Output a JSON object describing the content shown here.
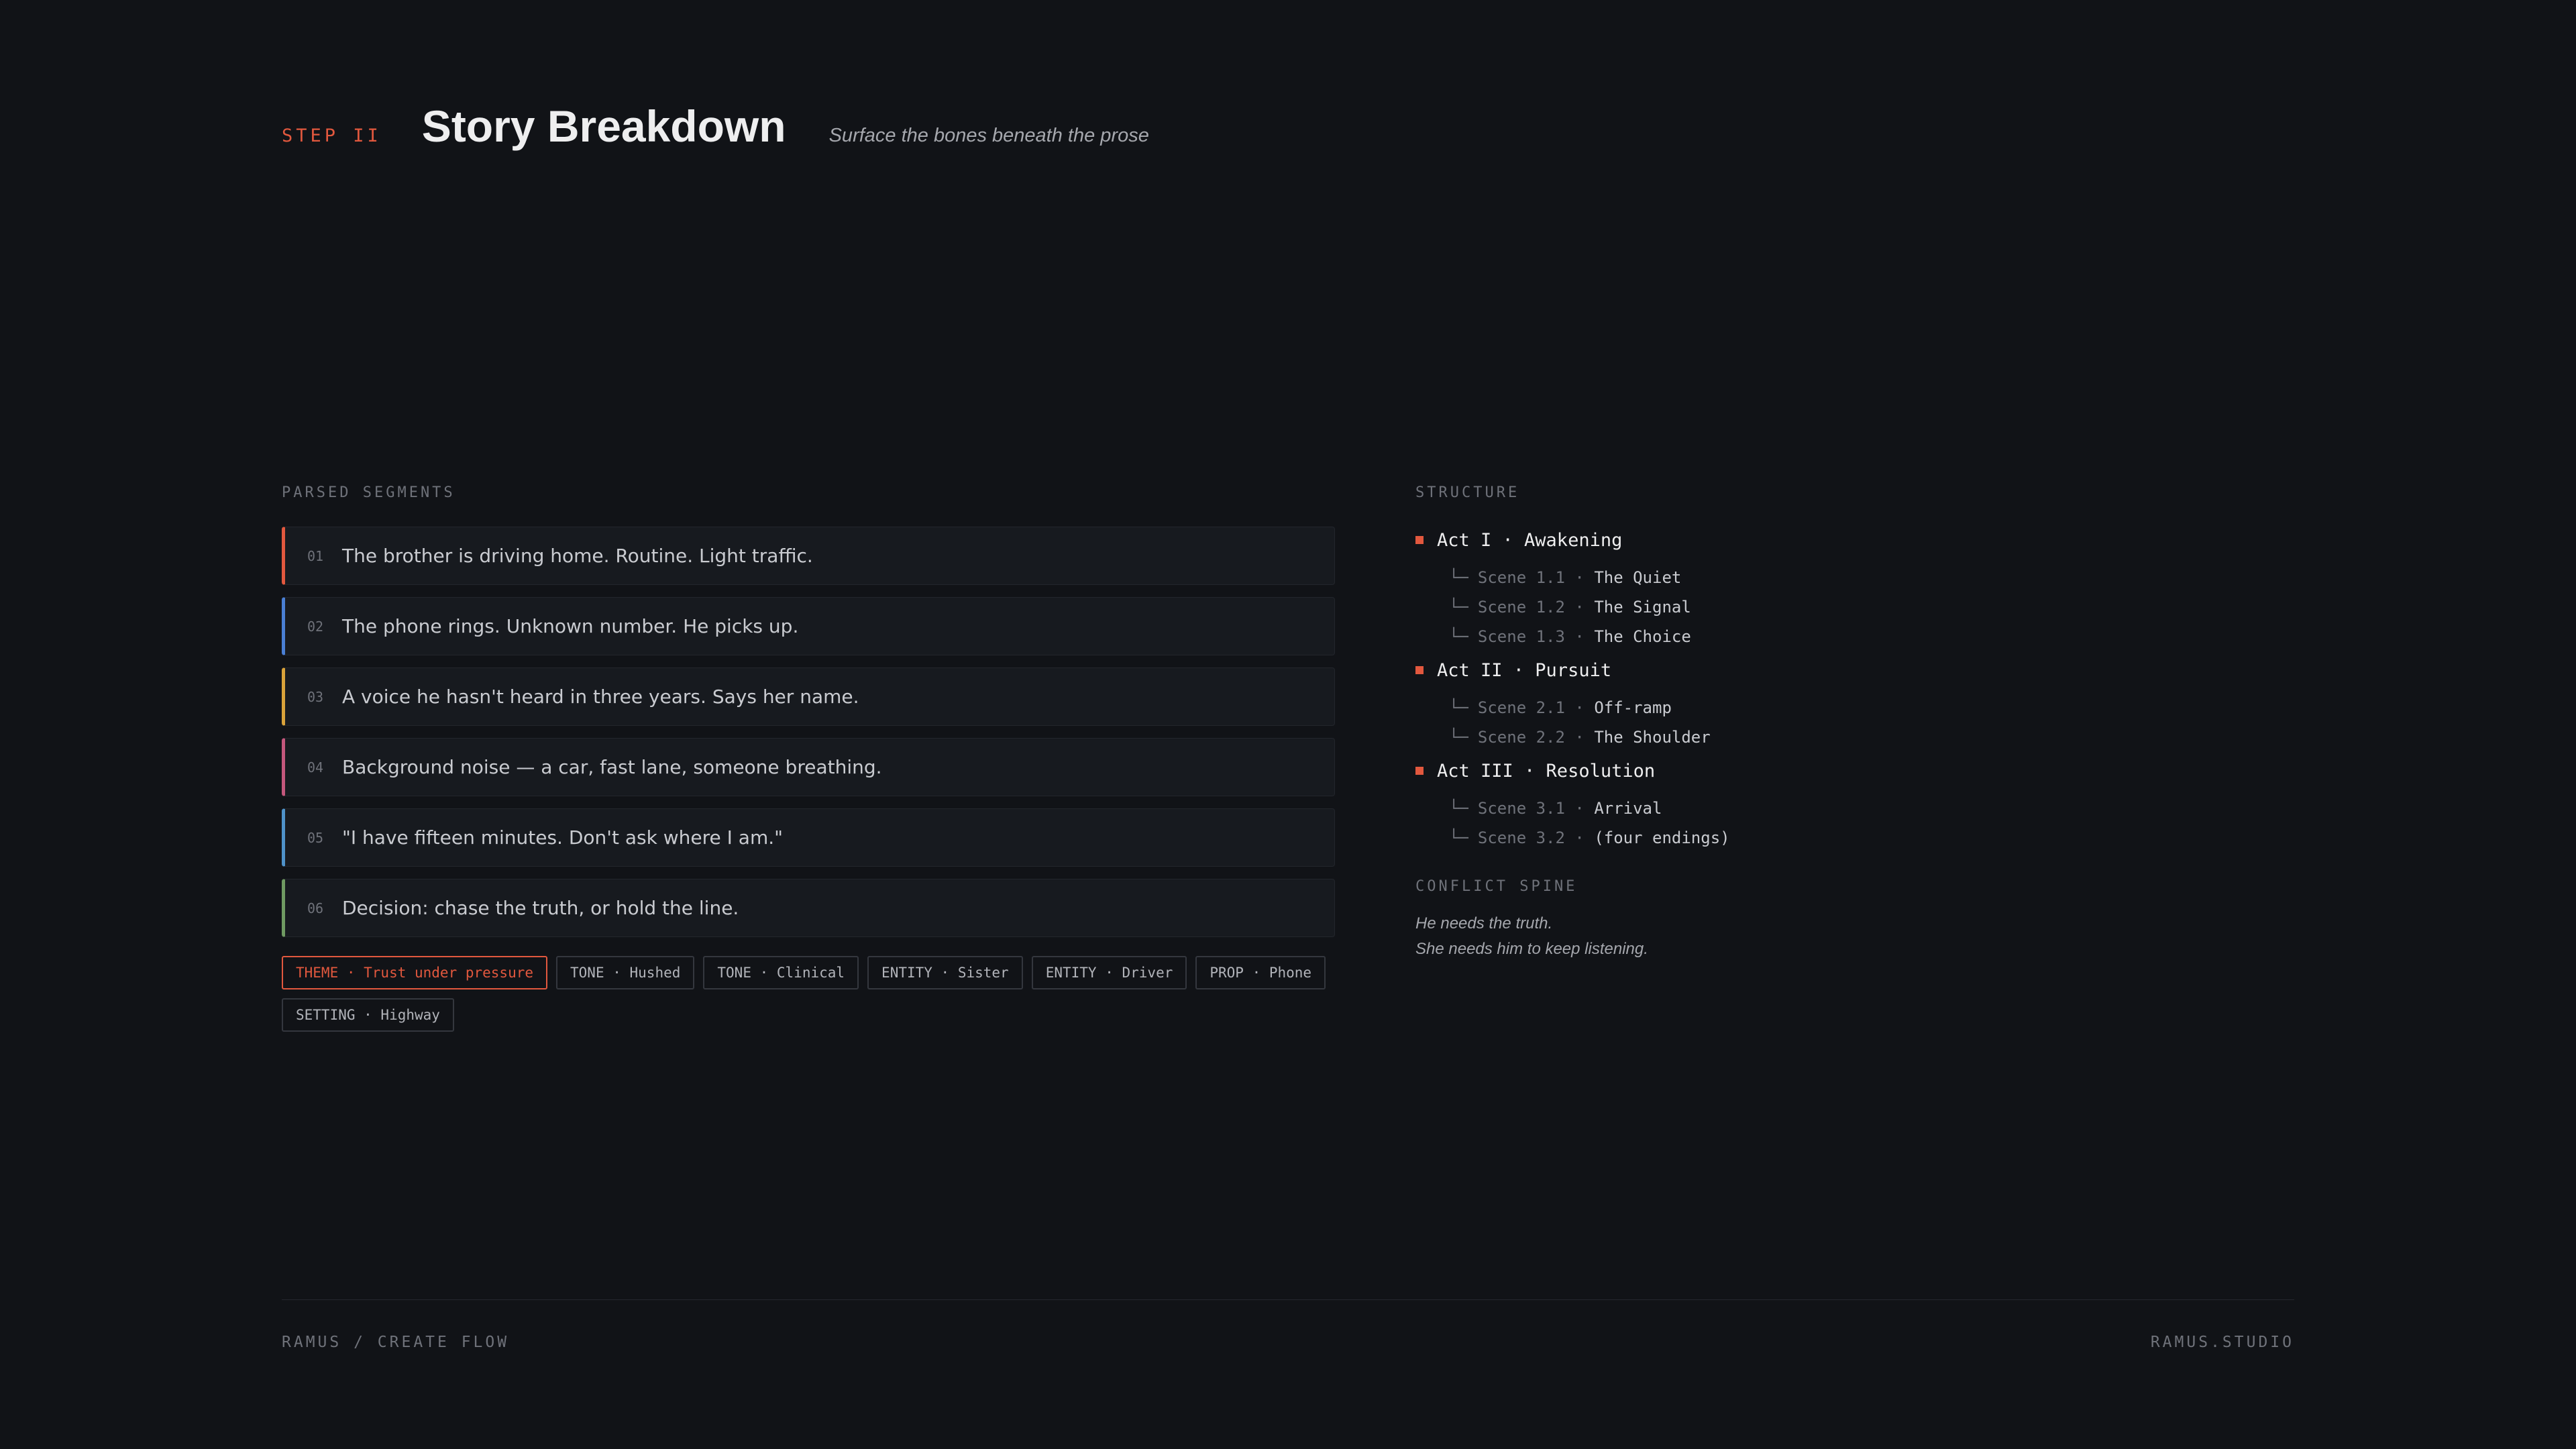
{
  "header": {
    "step": "STEP II",
    "title": "Story Breakdown",
    "subtitle": "Surface the bones beneath the prose"
  },
  "segments_section": {
    "label": "PARSED SEGMENTS",
    "items": [
      {
        "num": "01",
        "text": "The brother is driving home. Routine. Light traffic.",
        "color": "#e2583e"
      },
      {
        "num": "02",
        "text": "The phone rings. Unknown number. He picks up.",
        "color": "#4a7fd4"
      },
      {
        "num": "03",
        "text": "A voice he hasn't heard in three years. Says her name.",
        "color": "#d9a23a"
      },
      {
        "num": "04",
        "text": "Background noise — a car, fast lane, someone breathing.",
        "color": "#c4577c"
      },
      {
        "num": "05",
        "text": "\"I have fifteen minutes. Don't ask where I am.\"",
        "color": "#4f92c9"
      },
      {
        "num": "06",
        "text": "Decision: chase the truth, or hold the line.",
        "color": "#6f9a62"
      }
    ]
  },
  "tags": [
    {
      "text": "THEME · Trust under pressure",
      "primary": true
    },
    {
      "text": "TONE · Hushed"
    },
    {
      "text": "TONE · Clinical"
    },
    {
      "text": "ENTITY · Sister"
    },
    {
      "text": "ENTITY · Driver"
    },
    {
      "text": "PROP · Phone"
    },
    {
      "text": "SETTING · Highway"
    }
  ],
  "structure": {
    "label": "STRUCTURE",
    "acts": [
      {
        "title": "Act I · Awakening",
        "scenes": [
          {
            "label": "Scene 1.1",
            "name": "The Quiet"
          },
          {
            "label": "Scene 1.2",
            "name": "The Signal"
          },
          {
            "label": "Scene 1.3",
            "name": "The Choice"
          }
        ]
      },
      {
        "title": "Act II · Pursuit",
        "scenes": [
          {
            "label": "Scene 2.1",
            "name": "Off-ramp"
          },
          {
            "label": "Scene 2.2",
            "name": "The Shoulder"
          }
        ]
      },
      {
        "title": "Act III · Resolution",
        "scenes": [
          {
            "label": "Scene 3.1",
            "name": "Arrival"
          },
          {
            "label": "Scene 3.2",
            "name": "(four endings)"
          }
        ]
      }
    ]
  },
  "conflict": {
    "label": "CONFLICT SPINE",
    "line1": "He needs the truth.",
    "line2": "She needs him to keep listening."
  },
  "footer": {
    "left": "RAMUS / CREATE FLOW",
    "right": "RAMUS.STUDIO"
  },
  "colors": {
    "accent": "#e2583e",
    "background": "#111317"
  }
}
